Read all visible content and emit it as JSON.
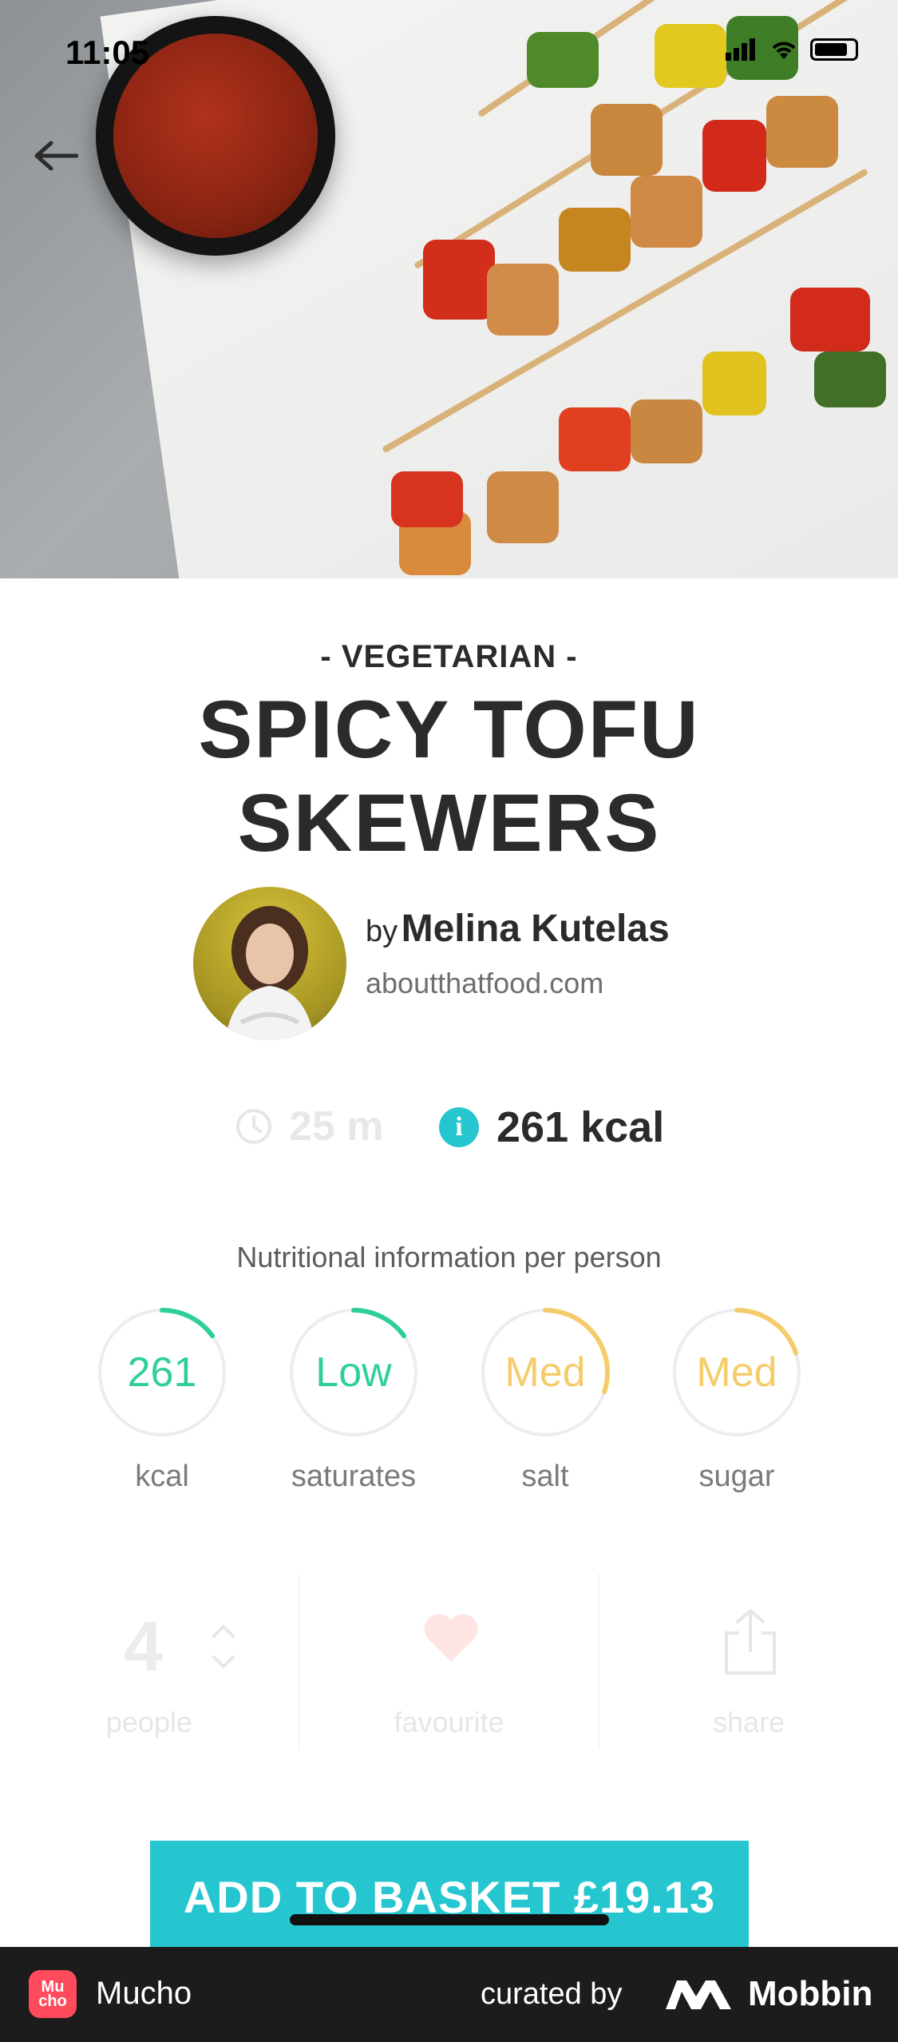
{
  "status_bar": {
    "time": "11:05"
  },
  "recipe": {
    "category": "- VEGETARIAN -",
    "title": "SPICY TOFU SKEWERS",
    "author": {
      "by": "by",
      "name": "Melina Kutelas",
      "website": "aboutthatfood.com"
    },
    "time": "25 m",
    "calories": "261 kcal"
  },
  "nutrition": {
    "heading": "Nutritional information per person",
    "items": [
      {
        "value": "261",
        "label": "kcal",
        "color": "#2ecf9a",
        "level": 0.15
      },
      {
        "value": "Low",
        "label": "saturates",
        "color": "#2ecf9a",
        "level": 0.15
      },
      {
        "value": "Med",
        "label": "salt",
        "color": "#f5cc6b",
        "level": 0.3
      },
      {
        "value": "Med",
        "label": "sugar",
        "color": "#f5cc6b",
        "level": 0.2
      }
    ]
  },
  "actions": {
    "people_count": "4",
    "people_label": "people",
    "favourite_label": "favourite",
    "share_label": "share"
  },
  "basket_button": {
    "label": "ADD TO BASKET £19.13"
  },
  "footer": {
    "app_icon_text": "Mu cho",
    "app_name": "Mucho",
    "curated_by": "curated by",
    "brand": "Mobbin"
  },
  "colors": {
    "accent": "#26c6d0",
    "green": "#2ecf9a",
    "amber": "#f5cc6b",
    "favourite": "#ff6b6b"
  }
}
